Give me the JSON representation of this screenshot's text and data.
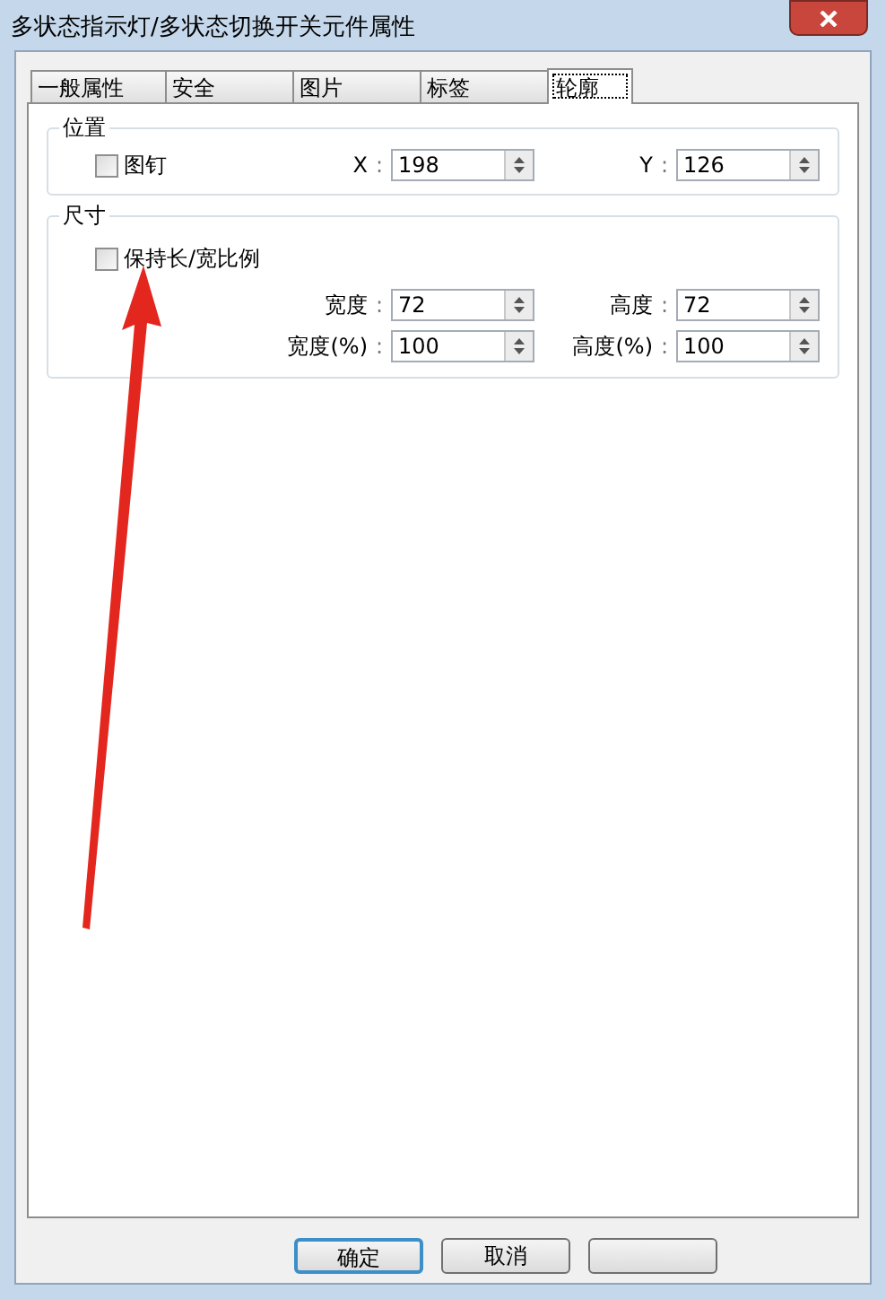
{
  "window": {
    "title": "多状态指示灯/多状态切换开关元件属性"
  },
  "tabs": [
    {
      "label": "一般属性",
      "selected": false
    },
    {
      "label": "安全",
      "selected": false
    },
    {
      "label": "图片",
      "selected": false
    },
    {
      "label": "标签",
      "selected": false
    },
    {
      "label": "轮廓",
      "selected": true
    }
  ],
  "position_group": {
    "title": "位置",
    "pin": {
      "label": "图钉",
      "checked": false
    },
    "fields": [
      {
        "label": "X",
        "separator": ":",
        "value": "198"
      },
      {
        "label": "Y",
        "separator": ":",
        "value": "126"
      }
    ]
  },
  "size_group": {
    "title": "尺寸",
    "keep_ratio": {
      "label": "保持长/宽比例",
      "checked": false
    },
    "fields": [
      {
        "label": "宽度",
        "separator": ":",
        "value": "72"
      },
      {
        "label": "高度",
        "separator": ":",
        "value": "72"
      },
      {
        "label": "宽度(%)",
        "separator": ":",
        "value": "100"
      },
      {
        "label": "高度(%)",
        "separator": ":",
        "value": "100"
      }
    ]
  },
  "buttons": [
    {
      "label": "确定",
      "default": true
    },
    {
      "label": "取消",
      "default": false
    },
    {
      "default": false
    }
  ],
  "annotation": {
    "kind": "arrow"
  }
}
